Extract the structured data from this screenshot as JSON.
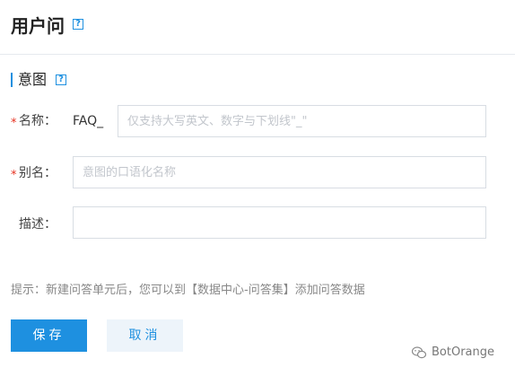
{
  "header": {
    "title": "用户问",
    "help_icon": "question-icon"
  },
  "section": {
    "title": "意图",
    "help_icon": "question-icon"
  },
  "form": {
    "name": {
      "required_mark": "*",
      "label": "名称：",
      "prefix": "FAQ_",
      "value": "",
      "placeholder": "仅支持大写英文、数字与下划线\"_\""
    },
    "alias": {
      "required_mark": "*",
      "label": "别名：",
      "value": "",
      "placeholder": "意图的口语化名称"
    },
    "description": {
      "label": "描述：",
      "value": "",
      "placeholder": ""
    }
  },
  "hint": "提示：新建问答单元后，您可以到【数据中心-问答集】添加问答数据",
  "buttons": {
    "save_label": "保存",
    "cancel_label": "取消"
  },
  "watermark": {
    "icon": "wechat-icon",
    "text": "BotOrange"
  },
  "colors": {
    "accent": "#1e90e0",
    "required": "#e6301f",
    "cancel_bg": "#edf4fa"
  }
}
